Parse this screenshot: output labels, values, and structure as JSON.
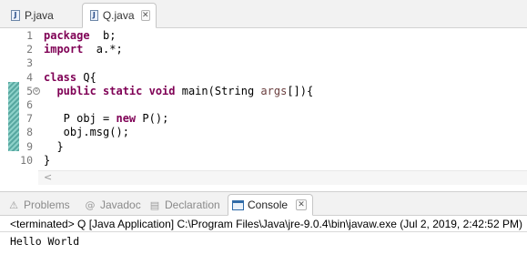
{
  "editor_tabs": [
    {
      "label": "P.java",
      "icon": "java-file-icon",
      "active": false
    },
    {
      "label": "Q.java",
      "icon": "java-file-icon",
      "active": true,
      "close": "✕"
    }
  ],
  "code_lines": [
    {
      "num": "1",
      "tokens": [
        [
          "kw",
          "package"
        ],
        [
          "",
          "  b;"
        ]
      ]
    },
    {
      "num": "2",
      "tokens": [
        [
          "kw",
          "import"
        ],
        [
          "",
          "  a.*;"
        ]
      ]
    },
    {
      "num": "3",
      "tokens": []
    },
    {
      "num": "4",
      "tokens": [
        [
          "kw",
          "class"
        ],
        [
          "",
          " Q{"
        ]
      ]
    },
    {
      "num": "5",
      "fold": "⊖",
      "tokens": [
        [
          "",
          "  "
        ],
        [
          "kw",
          "public static void"
        ],
        [
          "",
          " main(String "
        ],
        [
          "var",
          "args"
        ],
        [
          "",
          "[]){"
        ]
      ]
    },
    {
      "num": "6",
      "tokens": []
    },
    {
      "num": "7",
      "tokens": [
        [
          "",
          "   P obj = "
        ],
        [
          "kw",
          "new"
        ],
        [
          "",
          " P();"
        ]
      ]
    },
    {
      "num": "8",
      "tokens": [
        [
          "",
          "   obj.msg();"
        ]
      ]
    },
    {
      "num": "9",
      "tokens": [
        [
          "",
          "  }"
        ]
      ]
    },
    {
      "num": "10",
      "tokens": [
        [
          "",
          "}"
        ]
      ]
    }
  ],
  "scroll_left_arrow": "<",
  "panel_tabs": {
    "problems": "Problems",
    "javadoc": "Javadoc",
    "declaration": "Declaration",
    "console": "Console",
    "console_close": "✕",
    "javadoc_icon_glyph": "@",
    "problems_icon_glyph": "⚠",
    "declaration_icon_glyph": "▤"
  },
  "console": {
    "header": "<terminated> Q [Java Application] C:\\Program Files\\Java\\jre-9.0.4\\bin\\javaw.exe (Jul 2, 2019, 2:42:52 PM)",
    "output": "Hello World"
  },
  "colors": {
    "keyword": "#7f0055",
    "variable": "#6a3e3e",
    "line_number": "#787878",
    "change_bar": "#57a7a0"
  }
}
